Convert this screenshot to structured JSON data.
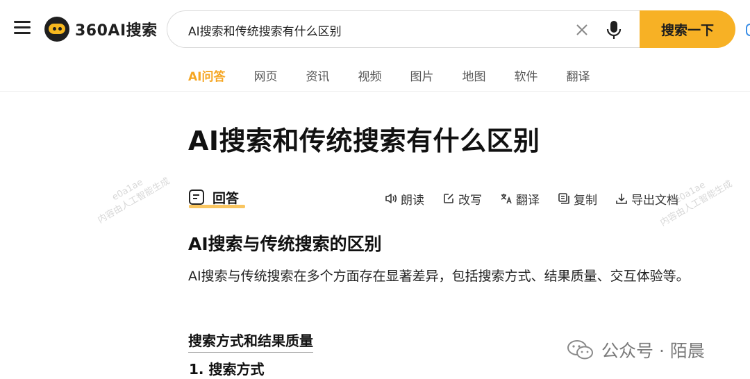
{
  "app": {
    "logo_text": "360AI搜索"
  },
  "search": {
    "query": "AI搜索和传统搜索有什么区别",
    "button_label": "搜索一下"
  },
  "tabs": [
    {
      "label": "AI问答",
      "active": true
    },
    {
      "label": "网页",
      "active": false
    },
    {
      "label": "资讯",
      "active": false
    },
    {
      "label": "视频",
      "active": false
    },
    {
      "label": "图片",
      "active": false
    },
    {
      "label": "地图",
      "active": false
    },
    {
      "label": "软件",
      "active": false
    },
    {
      "label": "翻译",
      "active": false
    }
  ],
  "page_title": "AI搜索和传统搜索有什么区别",
  "answer": {
    "label": "回答",
    "actions": [
      {
        "label": "朗读",
        "icon": "speaker-icon"
      },
      {
        "label": "改写",
        "icon": "edit-icon"
      },
      {
        "label": "翻译",
        "icon": "translate-icon"
      },
      {
        "label": "复制",
        "icon": "copy-icon"
      },
      {
        "label": "导出文档",
        "icon": "export-icon"
      }
    ]
  },
  "watermark": {
    "line1": "e0a1ae",
    "line2": "内容由人工智能生成"
  },
  "content": {
    "section_title": "AI搜索与传统搜索的区别",
    "paragraph": "AI搜索与传统搜索在多个方面存在显著差异，包括搜索方式、结果质量、交互体验等。",
    "sub_heading": "搜索方式和结果质量",
    "item_heading": "1. 搜索方式"
  },
  "wechat": {
    "label": "公众号 · 陌晨"
  },
  "colors": {
    "accent": "#f7b125",
    "active_tab": "#f5a623",
    "underline": "#f9c560"
  }
}
